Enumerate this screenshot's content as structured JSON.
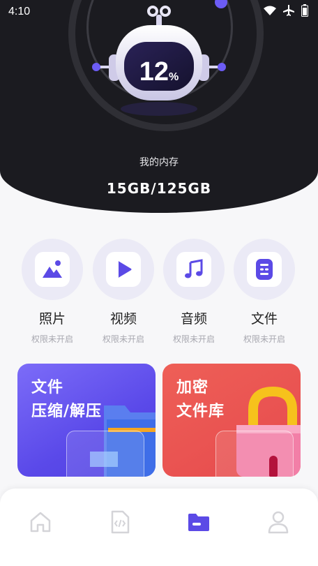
{
  "status_bar": {
    "time": "4:10"
  },
  "storage": {
    "percent": "12",
    "percent_sign": "%",
    "label": "我的内存",
    "value": "15GB/125GB",
    "used_fraction": 0.12
  },
  "categories": [
    {
      "name": "照片",
      "sub": "权限未开启",
      "icon": "image-icon"
    },
    {
      "name": "视频",
      "sub": "权限未开启",
      "icon": "play-icon"
    },
    {
      "name": "音频",
      "sub": "权限未开启",
      "icon": "music-icon"
    },
    {
      "name": "文件",
      "sub": "权限未开启",
      "icon": "document-icon"
    }
  ],
  "feature_cards": [
    {
      "title": "文件\n压缩/解压",
      "color": "#6b5cf0"
    },
    {
      "title": "加密\n文件库",
      "color": "#e9534f"
    }
  ],
  "nav": [
    {
      "icon": "home-icon",
      "active": false
    },
    {
      "icon": "code-file-icon",
      "active": false
    },
    {
      "icon": "folder-icon",
      "active": true
    },
    {
      "icon": "user-icon",
      "active": false
    }
  ],
  "colors": {
    "accent": "#6c5cf5",
    "header_bg": "#1b1b20",
    "inactive_icon": "#d4d4d8"
  }
}
